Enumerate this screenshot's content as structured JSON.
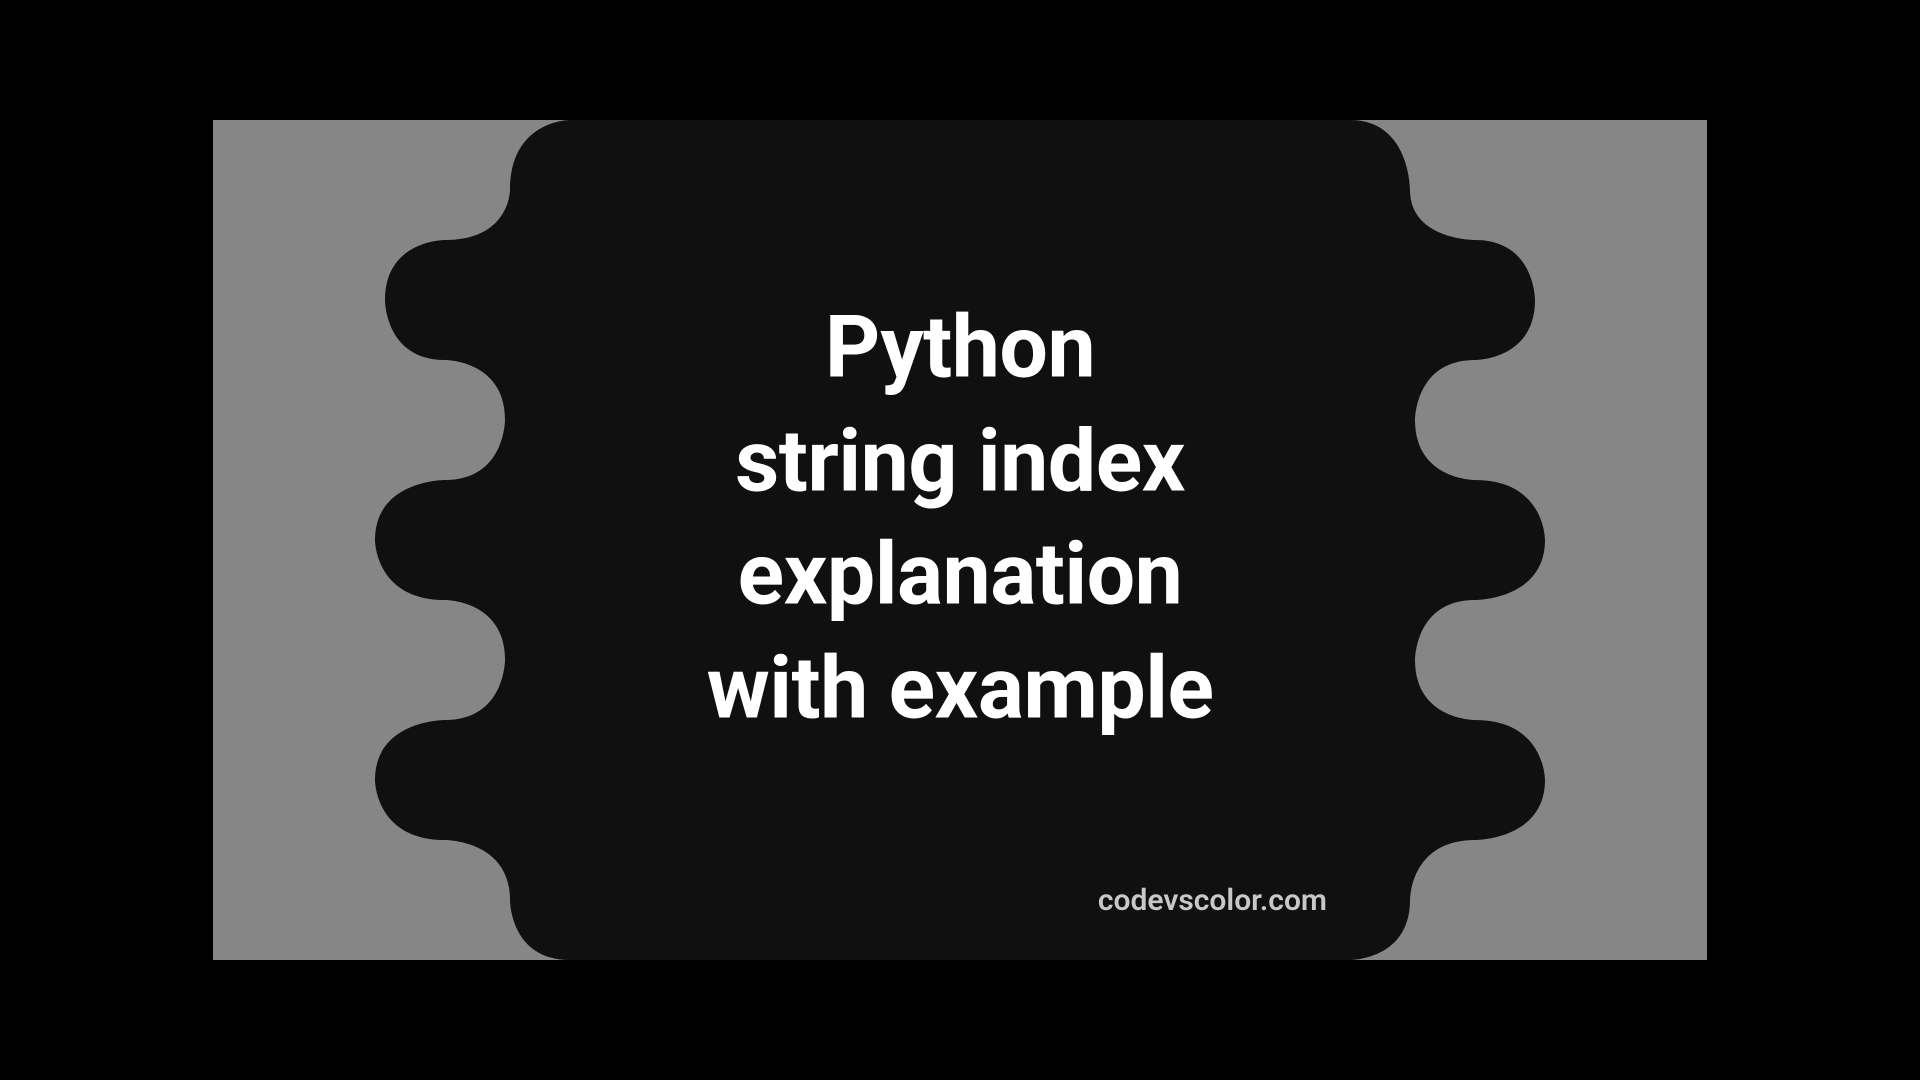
{
  "title_line1": "Python",
  "title_line2": "string index",
  "title_line3": "explanation",
  "title_line4": "with example",
  "watermark": "codevscolor.com",
  "colors": {
    "background_gray": "#868686",
    "blob_black": "#101010",
    "text_white": "#ffffff",
    "watermark_gray": "#c8c8c8"
  }
}
